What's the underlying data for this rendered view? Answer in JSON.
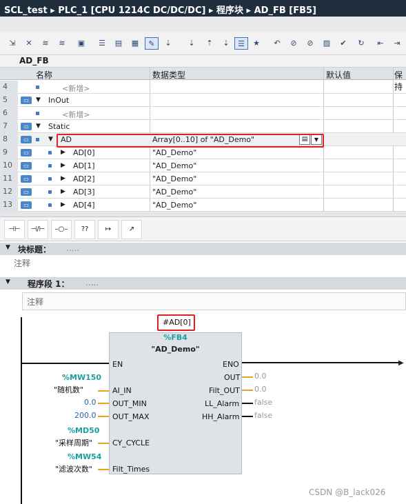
{
  "titlebar": {
    "path": "SCL_test ▸ PLC_1 [CPU 1214C DC/DC/DC] ▸ 程序块 ▸ AD_FB [FB5]"
  },
  "block_name": "AD_FB",
  "interface": {
    "headers": {
      "name": "名称",
      "type": "数据类型",
      "default": "默认值",
      "retain": "保持"
    },
    "rows": [
      {
        "no": "4",
        "name": "<新增>",
        "type": ""
      },
      {
        "no": "5",
        "name": "InOut",
        "type": ""
      },
      {
        "no": "6",
        "name": "<新增>",
        "type": ""
      },
      {
        "no": "7",
        "name": "Static",
        "type": ""
      },
      {
        "no": "8",
        "name": "AD",
        "type": "Array[0..10] of \"AD_Demo\""
      },
      {
        "no": "9",
        "name": "AD[0]",
        "type": "\"AD_Demo\""
      },
      {
        "no": "10",
        "name": "AD[1]",
        "type": "\"AD_Demo\""
      },
      {
        "no": "11",
        "name": "AD[2]",
        "type": "\"AD_Demo\""
      },
      {
        "no": "12",
        "name": "AD[3]",
        "type": "\"AD_Demo\""
      },
      {
        "no": "13",
        "name": "AD[4]",
        "type": "\"AD_Demo\""
      }
    ]
  },
  "block_title": {
    "label": "块标题：",
    "value": ".....",
    "comment": "注释"
  },
  "network": {
    "label": "程序段 1：",
    "value": ".....",
    "comment": "注释"
  },
  "fb": {
    "instance": "#AD[0]",
    "address": "%FB4",
    "name": "\"AD_Demo\"",
    "en": "EN",
    "eno": "ENO",
    "inputs": [
      {
        "pin": "AI_IN",
        "addr": "%MW150",
        "sym": "\"随机数\"",
        "val": ""
      },
      {
        "pin": "OUT_MIN",
        "addr": "",
        "sym": "",
        "val": "0.0"
      },
      {
        "pin": "OUT_MAX",
        "addr": "",
        "sym": "",
        "val": "200.0"
      },
      {
        "pin": "CY_CYCLE",
        "addr": "%MD50",
        "sym": "\"采样周期\"",
        "val": ""
      },
      {
        "pin": "Filt_Times",
        "addr": "%MW54",
        "sym": "\"滤波次数\"",
        "val": ""
      }
    ],
    "outputs": [
      {
        "pin": "OUT",
        "val": "0.0"
      },
      {
        "pin": "Filt_OUT",
        "val": "0.0"
      },
      {
        "pin": "LL_Alarm",
        "val": "false"
      },
      {
        "pin": "HH_Alarm",
        "val": "false"
      }
    ]
  },
  "watermark": "CSDN @B_lack026"
}
